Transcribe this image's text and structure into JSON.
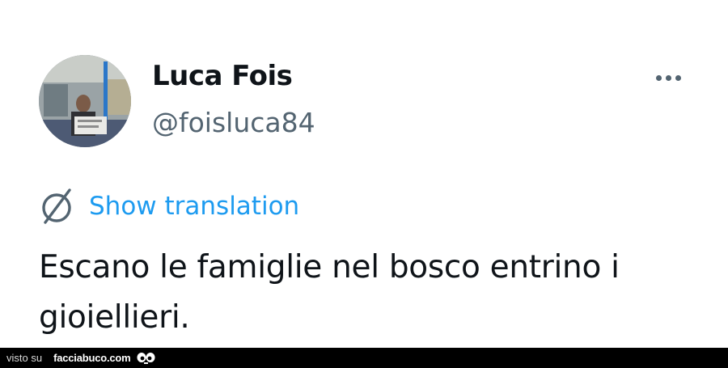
{
  "tweet": {
    "display_name": "Luca Fois",
    "handle": "@foisluca84",
    "more_icon": "more-horizontal-icon",
    "translation_icon": "translate-globe-icon",
    "translation_label": "Show translation",
    "text": "Escano le famiglie nel bosco entrino i gioiellieri."
  },
  "footer": {
    "prefix": "visto su",
    "site": "facciabuco.com",
    "logo_icon": "eyes-logo-icon"
  },
  "colors": {
    "link": "#1d9bf0",
    "secondary_text": "#536471",
    "primary_text": "#0f1419",
    "footer_background": "#000000"
  }
}
